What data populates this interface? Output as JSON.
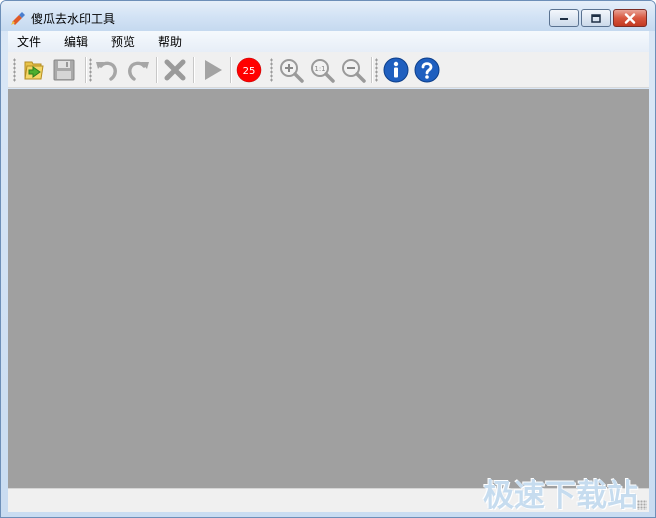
{
  "window": {
    "title": "傻瓜去水印工具"
  },
  "menu": [
    {
      "label": "文件"
    },
    {
      "label": "编辑"
    },
    {
      "label": "预览"
    },
    {
      "label": "帮助"
    }
  ],
  "toolbar": {
    "badge_value": "25",
    "zoom_reset_label": "1:1",
    "buttons": [
      {
        "icon": "open-folder-icon"
      },
      {
        "icon": "save-icon"
      },
      {
        "icon": "undo-icon"
      },
      {
        "icon": "redo-icon"
      },
      {
        "icon": "delete-icon"
      },
      {
        "icon": "play-icon"
      },
      {
        "icon": "badge-icon"
      },
      {
        "icon": "zoom-in-icon"
      },
      {
        "icon": "zoom-reset-icon"
      },
      {
        "icon": "zoom-out-icon"
      },
      {
        "icon": "info-icon"
      },
      {
        "icon": "help-icon"
      }
    ]
  },
  "watermark": {
    "text": "极速下载站"
  },
  "colors": {
    "canvas": "#a0a0a0",
    "badge": "#ff0000",
    "info_blue": "#1f5fbf",
    "close_red": "#c23a22",
    "folder_yellow": "#e8c349",
    "arrow_green": "#4caf2f"
  }
}
